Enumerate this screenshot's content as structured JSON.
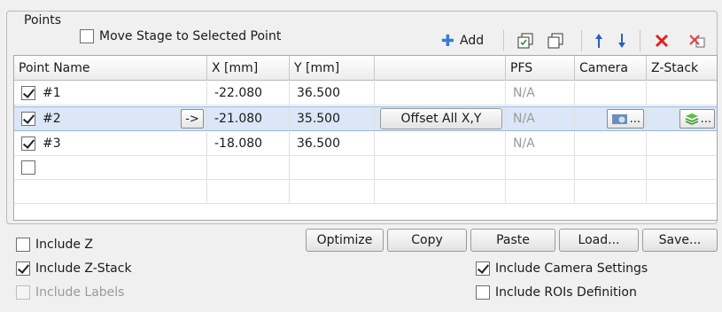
{
  "group_title": "Points",
  "move_stage": {
    "label": "Move Stage to Selected Point",
    "checked": false
  },
  "toolbar": {
    "add_label": "Add"
  },
  "columns": [
    "Point Name",
    "X [mm]",
    "Y [mm]",
    "",
    "PFS",
    "Camera",
    "Z-Stack"
  ],
  "rows": [
    {
      "checked": true,
      "name": "#1",
      "x": "-22.080",
      "y": "36.500",
      "pfs": "N/A"
    },
    {
      "checked": true,
      "name": "#2",
      "goto": "->",
      "x": "-21.080",
      "y": "35.500",
      "offset": "Offset All X,Y",
      "pfs": "N/A",
      "camera_btn": "...",
      "zstack_btn": "..."
    },
    {
      "checked": true,
      "name": "#3",
      "x": "-18.080",
      "y": "36.500",
      "pfs": "N/A"
    },
    {
      "checked": false
    }
  ],
  "buttons": {
    "optimize": "Optimize",
    "copy": "Copy",
    "paste": "Paste",
    "load": "Load...",
    "save": "Save..."
  },
  "options": {
    "include_z": {
      "label": "Include Z",
      "checked": false
    },
    "include_zstack": {
      "label": "Include Z-Stack",
      "checked": true
    },
    "include_labels": {
      "label": "Include Labels",
      "checked": false,
      "disabled": true
    },
    "include_camera": {
      "label": "Include Camera Settings",
      "checked": true
    },
    "include_rois": {
      "label": "Include ROIs Definition",
      "checked": false
    }
  },
  "colors": {
    "add_plus": "#3a7bd5",
    "arrows": "#2a5fc0",
    "delete": "#e02020",
    "selection": "#dbe7f6"
  }
}
